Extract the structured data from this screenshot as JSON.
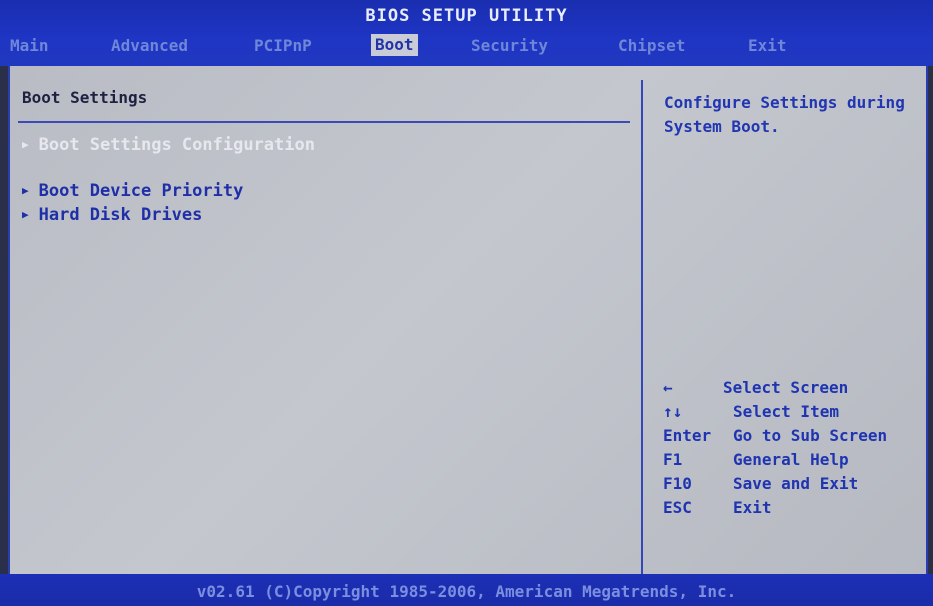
{
  "title": "BIOS SETUP UTILITY",
  "menu": {
    "items": [
      "Main",
      "Advanced",
      "PCIPnP",
      "Boot",
      "Security",
      "Chipset",
      "Exit"
    ],
    "active": "Boot"
  },
  "panel": {
    "section_title": "Boot Settings",
    "entries": [
      {
        "label": "Boot Settings Configuration",
        "selected": true
      },
      {
        "label": "Boot Device Priority",
        "selected": false
      },
      {
        "label": "Hard Disk Drives",
        "selected": false
      }
    ]
  },
  "help": {
    "text": "Configure Settings during System Boot."
  },
  "keys": [
    {
      "key": "←",
      "desc": "Select Screen"
    },
    {
      "key": "↑↓",
      "desc": "Select Item"
    },
    {
      "key": "Enter",
      "desc": "Go to Sub Screen"
    },
    {
      "key": "F1",
      "desc": "General Help"
    },
    {
      "key": "F10",
      "desc": "Save and Exit"
    },
    {
      "key": "ESC",
      "desc": "Exit"
    }
  ],
  "footer": {
    "text": "v02.61 (C)Copyright 1985-2006, American Megatrends, Inc."
  },
  "colors": {
    "bar_blue": "#1f35c4",
    "panel_gray": "#c4c7ce",
    "highlight_text": "#1f2fa8"
  }
}
